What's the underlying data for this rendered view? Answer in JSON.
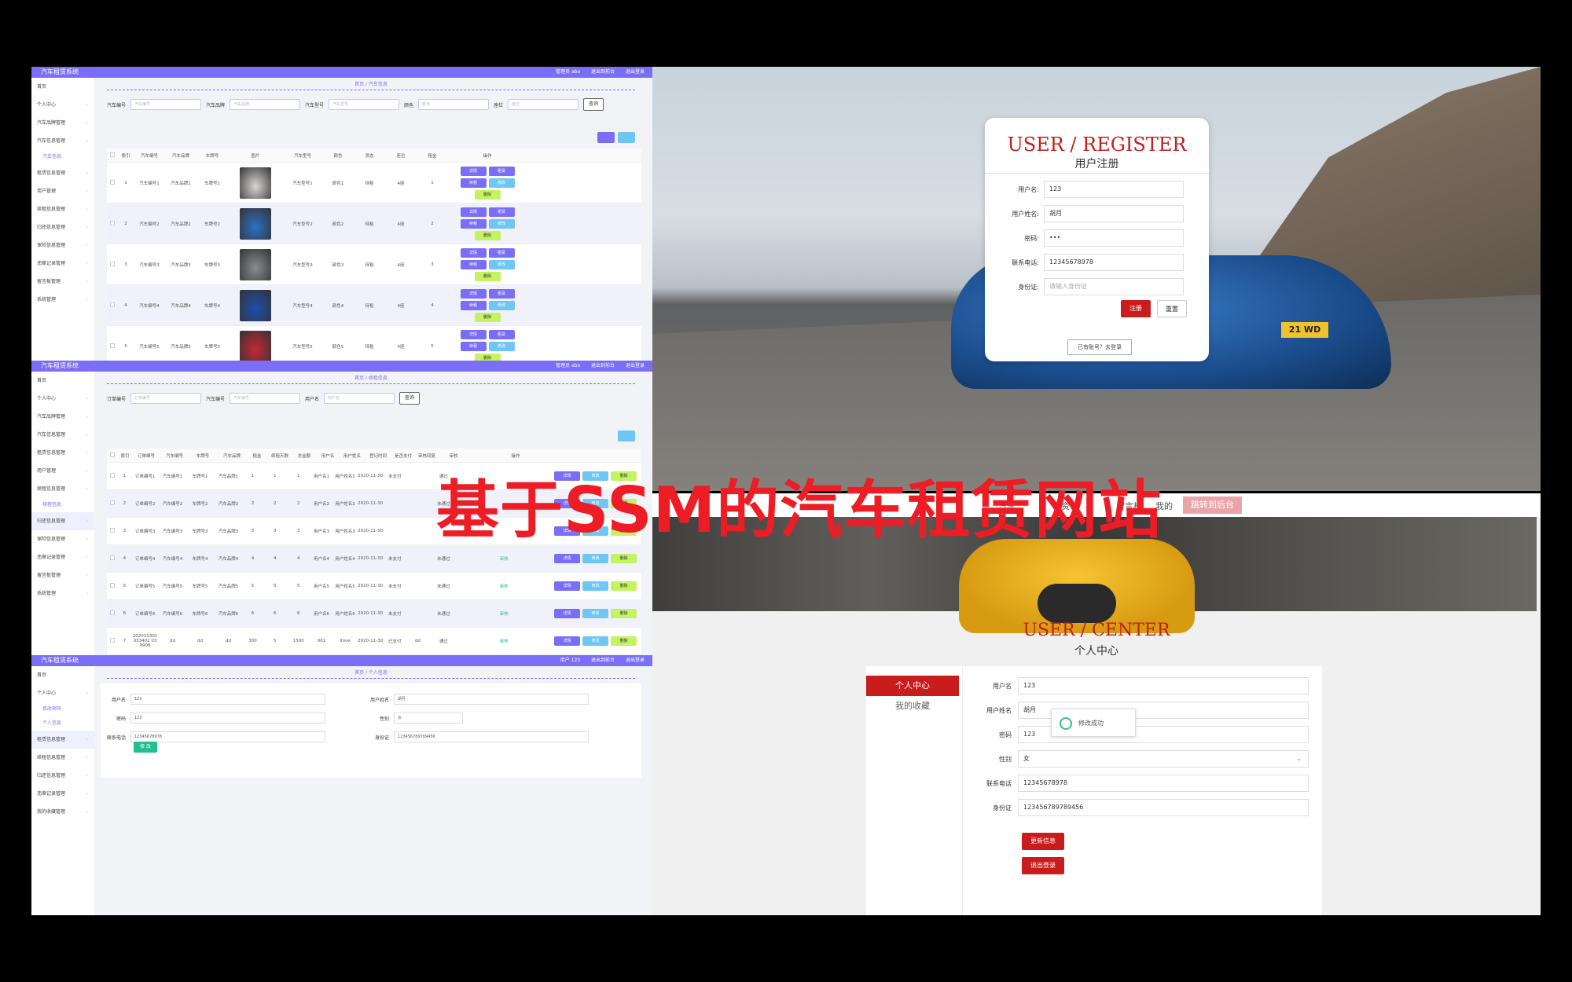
{
  "overlay_title": "基于SSM的汽车租赁网站",
  "colors": {
    "accent": "#7b6ef6",
    "brand_red": "#c91d1d",
    "title_red": "#ee1c24"
  },
  "panel1": {
    "app_title": "汽车租赁系统",
    "top_links": [
      "管理员 abo",
      "退出到前台",
      "退出登录"
    ],
    "breadcrumb": "首页 / 汽车信息",
    "sidebar": [
      {
        "label": "首页",
        "type": "home"
      },
      {
        "label": "个人中心"
      },
      {
        "label": "汽车品牌管理"
      },
      {
        "label": "汽车信息管理"
      },
      {
        "label": "汽车信息",
        "type": "sub"
      },
      {
        "label": "租赁信息管理"
      },
      {
        "label": "用户管理"
      },
      {
        "label": "续租信息管理"
      },
      {
        "label": "归还信息管理"
      },
      {
        "label": "保险信息管理"
      },
      {
        "label": "违章记录管理"
      },
      {
        "label": "留言板管理"
      },
      {
        "label": "系统管理"
      }
    ],
    "filters": [
      {
        "label": "汽车编号",
        "placeholder": "汽车编号"
      },
      {
        "label": "汽车品牌",
        "placeholder": "汽车品牌"
      },
      {
        "label": "汽车型号",
        "placeholder": "汽车型号"
      },
      {
        "label": "颜色",
        "placeholder": "颜色"
      },
      {
        "label": "座位",
        "placeholder": "座位"
      }
    ],
    "search_label": "查询",
    "columns": [
      "",
      "索引",
      "汽车编号",
      "汽车品牌",
      "车牌号",
      "图片",
      "汽车型号",
      "颜色",
      "状态",
      "座位",
      "租金",
      "操作"
    ],
    "rows": [
      [
        "1",
        "汽车编号1",
        "汽车品牌1",
        "车牌号1",
        "",
        "汽车型号1",
        "颜色1",
        "待租",
        "4座",
        "1"
      ],
      [
        "2",
        "汽车编号2",
        "汽车品牌2",
        "车牌号2",
        "",
        "汽车型号2",
        "颜色2",
        "待租",
        "4座",
        "2"
      ],
      [
        "3",
        "汽车编号3",
        "汽车品牌3",
        "车牌号3",
        "",
        "汽车型号3",
        "颜色3",
        "待租",
        "4座",
        "3"
      ],
      [
        "4",
        "汽车编号4",
        "汽车品牌4",
        "车牌号4",
        "",
        "汽车型号4",
        "颜色4",
        "待租",
        "4座",
        "4"
      ],
      [
        "5",
        "汽车编号5",
        "汽车品牌5",
        "车牌号5",
        "",
        "汽车型号5",
        "颜色5",
        "待租",
        "4座",
        "5"
      ]
    ],
    "car_colors": [
      "#d8d6d2",
      "#2e6fc2",
      "#8a8c8f",
      "#1d4fb0",
      "#c62834"
    ],
    "ops": [
      "详情",
      "租赁",
      "续租",
      "修改",
      "删除"
    ]
  },
  "panel2": {
    "app_title": "汽车租赁系统",
    "top_links": [
      "管理员 abo",
      "退出到前台",
      "退出登录"
    ],
    "breadcrumb": "首页 / 续租信息",
    "sidebar": [
      {
        "label": "首页",
        "type": "home"
      },
      {
        "label": "个人中心"
      },
      {
        "label": "汽车品牌管理"
      },
      {
        "label": "汽车信息管理"
      },
      {
        "label": "租赁信息管理"
      },
      {
        "label": "用户管理"
      },
      {
        "label": "续租信息管理"
      },
      {
        "label": "续租信息",
        "type": "sub"
      },
      {
        "label": "归还信息管理",
        "active": true
      },
      {
        "label": "保险信息管理"
      },
      {
        "label": "违章记录管理"
      },
      {
        "label": "留言板管理"
      },
      {
        "label": "系统管理"
      }
    ],
    "filters": [
      {
        "label": "订单编号",
        "placeholder": "订单编号"
      },
      {
        "label": "汽车编号",
        "placeholder": "汽车编号"
      },
      {
        "label": "用户名",
        "placeholder": "用户名"
      }
    ],
    "search_label": "查询",
    "columns": [
      "",
      "索引",
      "订单编号",
      "汽车编号",
      "车牌号",
      "汽车品牌",
      "租金",
      "续租天数",
      "总金额",
      "用户名",
      "用户姓名",
      "登记时间",
      "是否支付",
      "审核回复",
      "审核",
      "操作"
    ],
    "rows": [
      [
        "1",
        "订单编号1",
        "汽车编号1",
        "车牌号1",
        "汽车品牌1",
        "1",
        "1",
        "1",
        "用户名1",
        "用户姓名1",
        "2020-11-30",
        "未支付",
        "",
        "通过",
        ""
      ],
      [
        "2",
        "订单编号2",
        "汽车编号2",
        "车牌号2",
        "汽车品牌2",
        "2",
        "2",
        "2",
        "用户名2",
        "用户姓名2",
        "2020-11-30",
        "",
        "",
        "未通过",
        ""
      ],
      [
        "3",
        "订单编号3",
        "汽车编号3",
        "车牌号3",
        "汽车品牌3",
        "3",
        "3",
        "3",
        "用户名3",
        "用户姓名3",
        "2020-11-30",
        "",
        "",
        "",
        ""
      ],
      [
        "4",
        "订单编号4",
        "汽车编号4",
        "车牌号4",
        "汽车品牌4",
        "4",
        "4",
        "4",
        "用户名4",
        "用户姓名4",
        "2020-11-30",
        "未支付",
        "",
        "未通过",
        "审核"
      ],
      [
        "5",
        "订单编号5",
        "汽车编号5",
        "车牌号5",
        "汽车品牌5",
        "5",
        "5",
        "5",
        "用户名5",
        "用户姓名5",
        "2020-11-30",
        "未支付",
        "",
        "未通过",
        "审核"
      ],
      [
        "6",
        "订单编号6",
        "汽车编号6",
        "车牌号6",
        "汽车品牌6",
        "6",
        "6",
        "6",
        "用户名6",
        "用户姓名6",
        "2020-11-30",
        "未支付",
        "",
        "未通过",
        "审核"
      ],
      [
        "7",
        "202011301 033402 03 9908",
        "dd",
        "dd",
        "dd",
        "300",
        "5",
        "1500",
        "001",
        "llove",
        "2020-11-30",
        "已支付",
        "dd",
        "通过",
        "审核"
      ]
    ],
    "ops": [
      "详情",
      "修改",
      "删除"
    ]
  },
  "panel3": {
    "app_title": "汽车租赁系统",
    "top_links": [
      "用户 123",
      "退出到前台",
      "退出登录"
    ],
    "breadcrumb": "首页 / 个人信息",
    "sidebar": [
      {
        "label": "首页",
        "type": "home"
      },
      {
        "label": "个人中心"
      },
      {
        "label": "修改密码",
        "type": "sub"
      },
      {
        "label": "个人信息",
        "type": "sub"
      },
      {
        "label": "租赁信息管理",
        "active": true
      },
      {
        "label": "续租信息管理"
      },
      {
        "label": "归还信息管理"
      },
      {
        "label": "违章记录管理"
      },
      {
        "label": "我的收藏管理"
      }
    ],
    "fields_left": [
      {
        "label": "用户名",
        "value": "123"
      },
      {
        "label": "密码",
        "value": "123"
      },
      {
        "label": "联系电话",
        "value": "12345678978"
      }
    ],
    "fields_right": [
      {
        "label": "用户姓名",
        "value": "胡月"
      },
      {
        "label": "性别",
        "value": "女"
      },
      {
        "label": "身份证",
        "value": "123456789789456"
      }
    ],
    "submit_label": "修 改"
  },
  "register": {
    "title_en": "USER / REGISTER",
    "title_cn": "用户注册",
    "plate": "21 WD",
    "fields": [
      {
        "label": "用户名:",
        "value": "123"
      },
      {
        "label": "用户姓名:",
        "value": "胡月"
      },
      {
        "label": "密码:",
        "value": "•••"
      },
      {
        "label": "联系电话:",
        "value": "12345678978"
      },
      {
        "label": "身份证:",
        "value": "",
        "placeholder": "请输入身份证"
      }
    ],
    "register_btn": "注册",
    "reset_btn": "重置",
    "to_login": "已有账号？去登录"
  },
  "center": {
    "nav": [
      "汽车",
      "资讯",
      "留言板",
      "我的",
      "跳转到后台"
    ],
    "title_en": "USER / CENTER",
    "title_cn": "个人中心",
    "menu": [
      "个人中心",
      "我的收藏"
    ],
    "fields": [
      {
        "label": "用户名",
        "value": "123"
      },
      {
        "label": "用户姓名",
        "value": "胡月"
      },
      {
        "label": "密码",
        "value": "123"
      },
      {
        "label": "性别",
        "value": "女"
      },
      {
        "label": "联系电话",
        "value": "12345678978"
      },
      {
        "label": "身份证",
        "value": "123456789789456"
      }
    ],
    "update_btn": "更新信息",
    "logout_btn": "退出登录",
    "toast": "修改成功"
  }
}
